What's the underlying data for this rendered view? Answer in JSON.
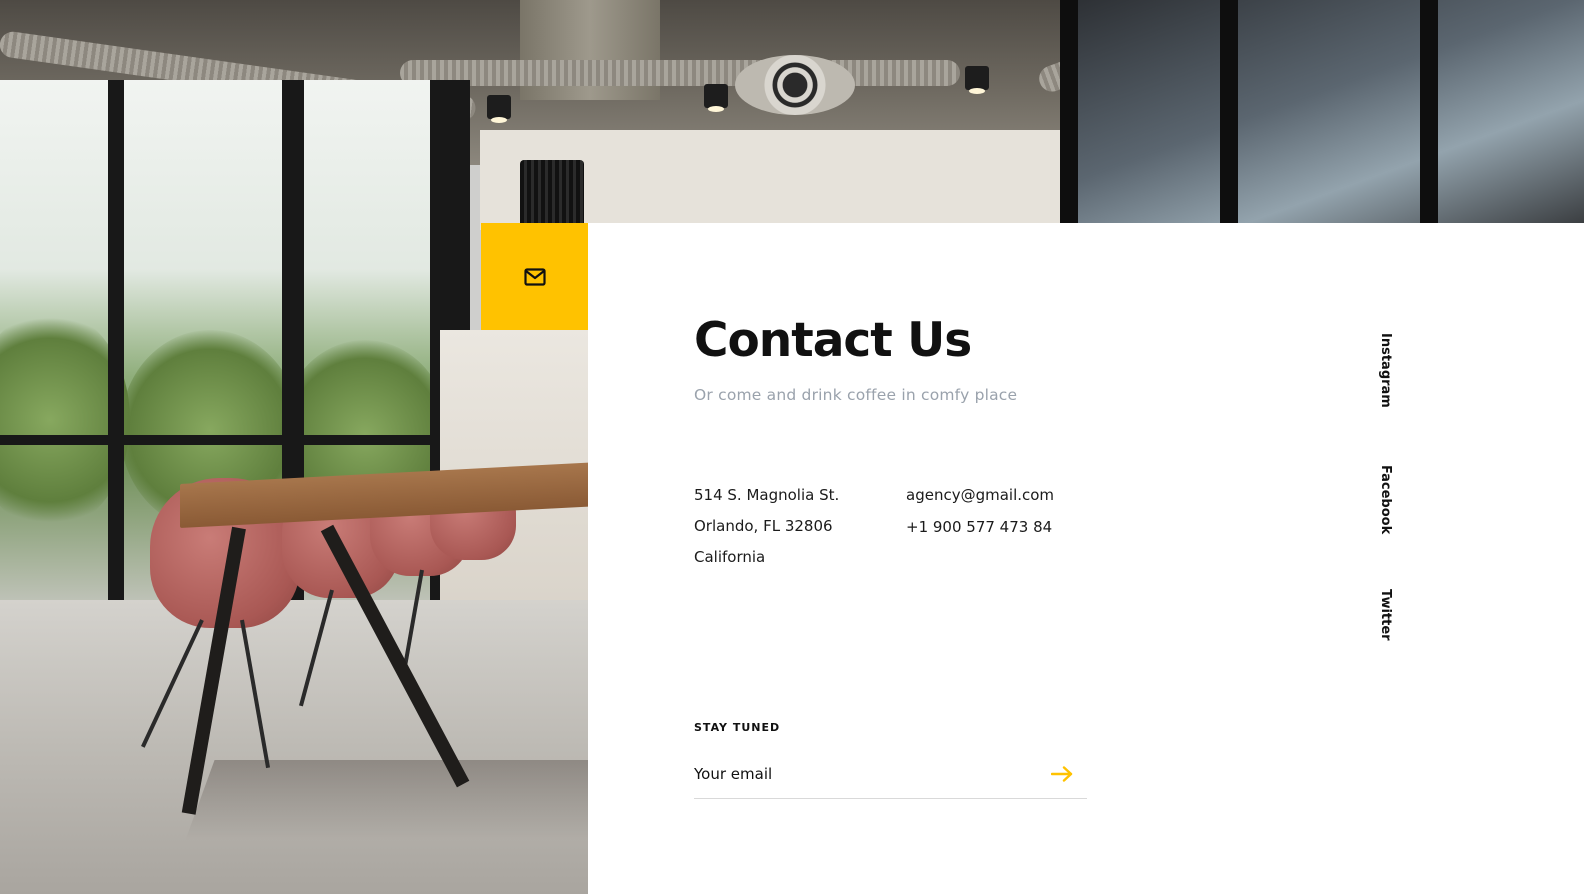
{
  "contact": {
    "title": "Contact Us",
    "subtitle": "Or come and drink coffee in comfy place",
    "address": [
      "514 S. Magnolia St.",
      "Orlando, FL 32806",
      "California"
    ],
    "email": "agency@gmail.com",
    "phone": "+1 900 577 473 84"
  },
  "social": {
    "links": [
      "Instagram",
      "Facebook",
      "Twitter"
    ]
  },
  "newsletter": {
    "label": "STAY TUNED",
    "placeholder": "Your email"
  },
  "icons": {
    "mail": "mail-icon",
    "submit": "arrow-right-icon"
  },
  "colors": {
    "accent": "#ffc200",
    "text": "#111111",
    "muted": "#9aa2ac",
    "panel": "#ffffff"
  }
}
